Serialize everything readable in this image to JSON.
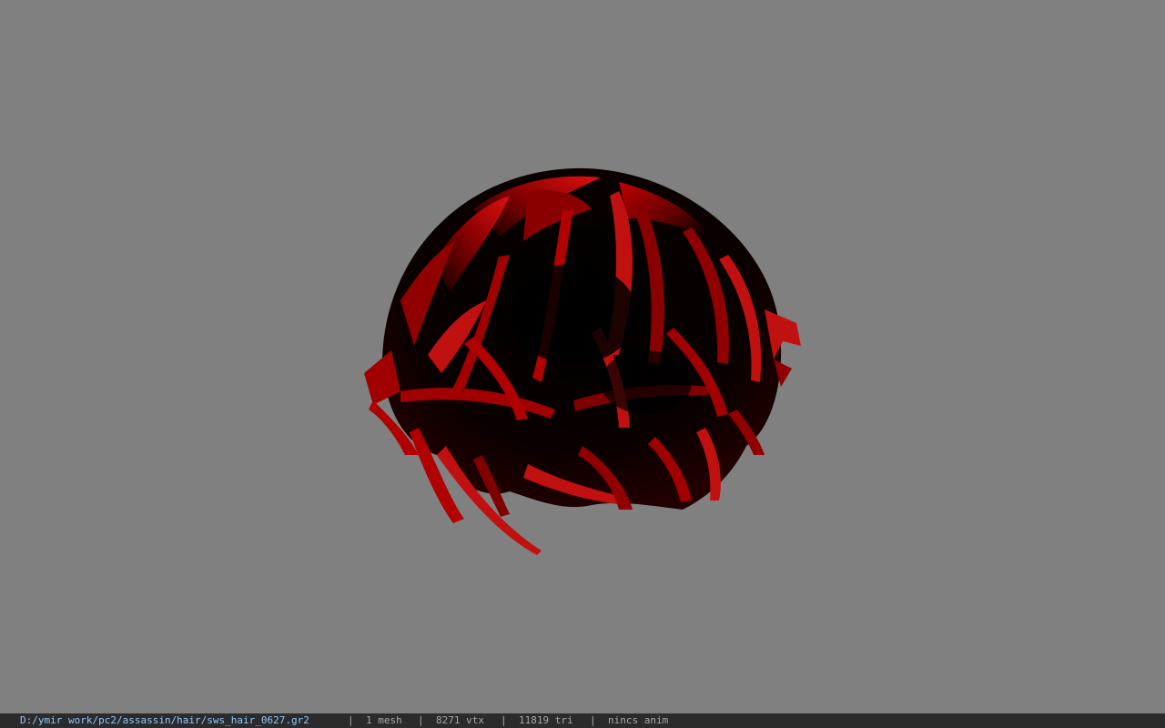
{
  "viewer": {
    "background_color": "#808080",
    "model": {
      "kind": "hair-mesh",
      "colors": {
        "base": "#000000",
        "highlight": "#b00000",
        "bright": "#e01010"
      }
    }
  },
  "statusbar": {
    "path": "D:/ymir work/pc2/assassin/hair/sws_hair_0627.gr2",
    "separator": "|",
    "mesh": "1 mesh",
    "vertices": "8271 vtx",
    "triangles": "11819 tri",
    "anim": "nincs anim"
  }
}
